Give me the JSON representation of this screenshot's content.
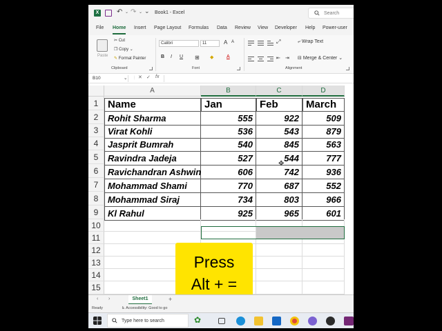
{
  "window": {
    "app_logo": "X",
    "title": "Book1 - Excel",
    "search_placeholder": "Search",
    "icons": [
      "excel-logo-icon",
      "save-icon",
      "undo-icon",
      "redo-icon",
      "quick-access-more-icon",
      "search-icon"
    ]
  },
  "ribbon_tabs": [
    "File",
    "Home",
    "Insert",
    "Page Layout",
    "Formulas",
    "Data",
    "Review",
    "View",
    "Developer",
    "Help",
    "Power-user"
  ],
  "active_tab": "Home",
  "ribbon": {
    "paste_label": "Paste",
    "cut_label": "Cut",
    "copy_label": "Copy",
    "format_painter_label": "Format Painter",
    "clipboard_group": "Clipboard",
    "font_name": "Calibri",
    "font_size": "11",
    "grow_font": "A",
    "shrink_font": "A",
    "bold": "B",
    "italic": "I",
    "underline": "U",
    "font_color_letter": "A",
    "font_group": "Font",
    "wrap_text_label": "Wrap Text",
    "merge_center_label": "Merge & Center",
    "alignment_group": "Alignment"
  },
  "formula_bar": {
    "name_box": "B10",
    "cancel_symbol": "✕",
    "enter_symbol": "✓",
    "fx_label": "fx",
    "value": ""
  },
  "columns": [
    "A",
    "B",
    "C",
    "D"
  ],
  "selected_columns": [
    "B",
    "C",
    "D"
  ],
  "rows": [
    "1",
    "2",
    "3",
    "4",
    "5",
    "6",
    "7",
    "8",
    "9",
    "10",
    "11",
    "12",
    "13",
    "14",
    "15"
  ],
  "table": {
    "headers": [
      "Name",
      "Jan",
      "Feb",
      "March"
    ],
    "data": [
      [
        "Rohit Sharma",
        "555",
        "922",
        "509"
      ],
      [
        "Virat Kohli",
        "536",
        "543",
        "879"
      ],
      [
        "Jasprit Bumrah",
        "540",
        "845",
        "563"
      ],
      [
        "Ravindra Jadeja",
        "527",
        "544",
        "777"
      ],
      [
        "Ravichandran Ashwin",
        "606",
        "742",
        "936"
      ],
      [
        "Mohammad Shami",
        "770",
        "687",
        "552"
      ],
      [
        "Mohammad Siraj",
        "734",
        "803",
        "966"
      ],
      [
        "Kl Rahul",
        "925",
        "965",
        "601"
      ]
    ]
  },
  "overlay": {
    "line1": "Press",
    "line2": "Alt + =",
    "color": "#ffe400"
  },
  "sheet_tabs": [
    "Sheet1"
  ],
  "add_sheet": "+",
  "status": {
    "ready": "Ready",
    "accessibility": "Accessibility: Good to go"
  },
  "taskbar": {
    "search_placeholder": "Type here to search",
    "icons": [
      "windows-start-icon",
      "taskbar-search-icon",
      "plant-widget-icon",
      "task-view-icon",
      "edge-icon",
      "file-explorer-icon",
      "mail-icon",
      "chrome-icon",
      "copilot-icon",
      "app-icon",
      "powerapps-icon"
    ]
  },
  "accent_color": "#1e6c3d"
}
